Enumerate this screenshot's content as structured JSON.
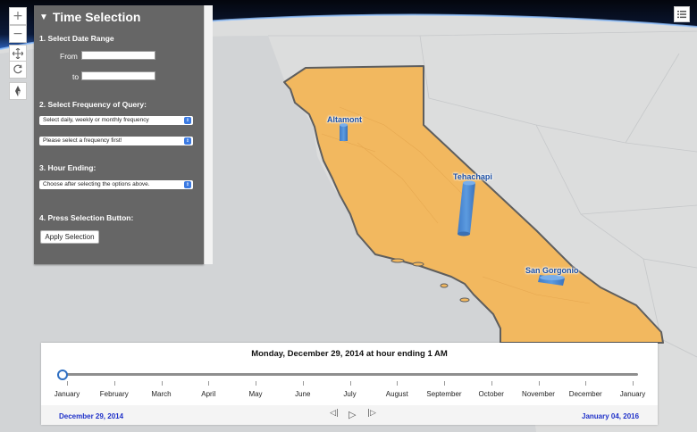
{
  "nav": {
    "zoom_in": "+",
    "zoom_out": "−"
  },
  "panel": {
    "title": "Time Selection",
    "step1": "1. Select Date Range",
    "from_label": "From",
    "from_value": "",
    "to_label": "to",
    "to_value": "",
    "step2": "2. Select Frequency of Query:",
    "frequency_select": "Select daily, weekly or monthly frequency",
    "frequency_detail_select": "Please select a frequency first!",
    "step3": "3. Hour Ending:",
    "hour_select": "Choose after selecting the options above.",
    "step4": "4. Press Selection Button:",
    "apply_label": "Apply Selection"
  },
  "map": {
    "sites": [
      {
        "name": "Altamont"
      },
      {
        "name": "Tehachapi"
      },
      {
        "name": "San Gorgonio"
      }
    ],
    "colors": {
      "california": "#f2b85f",
      "column": "#4f8fd6",
      "ocean": "#d4d6d8"
    }
  },
  "timeline": {
    "title": "Monday, December 29, 2014 at hour ending 1 AM",
    "months": [
      "January",
      "February",
      "March",
      "April",
      "May",
      "June",
      "July",
      "August",
      "September",
      "October",
      "November",
      "December",
      "January"
    ],
    "start_date": "December 29, 2014",
    "end_date": "January 04, 2016",
    "prev_icon": "◁|",
    "play_icon": "▷",
    "next_icon": "|▷"
  }
}
